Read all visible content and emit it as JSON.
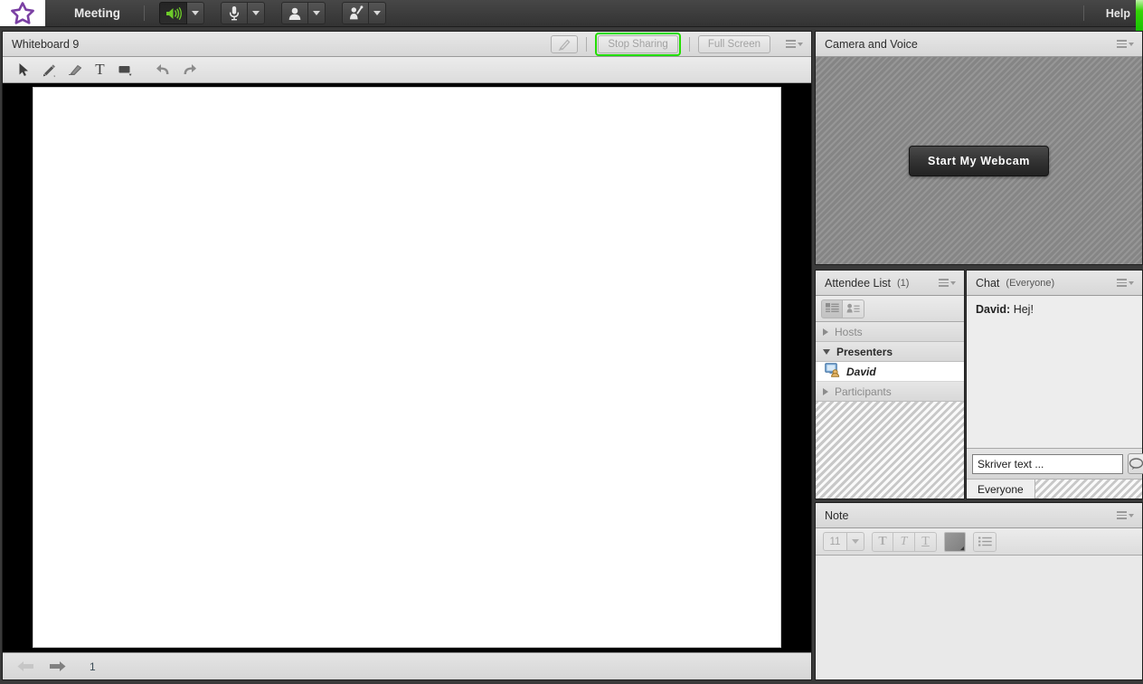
{
  "appbar": {
    "logo_icon": "star-logo-icon",
    "menu_label": "Meeting",
    "help_label": "Help",
    "controls": [
      {
        "name": "speaker-button",
        "icon": "speaker-icon",
        "state": "active",
        "accent": "#6ecc2a"
      },
      {
        "name": "microphone-button",
        "icon": "microphone-icon",
        "state": "normal"
      },
      {
        "name": "webcam-button",
        "icon": "person-icon",
        "state": "normal"
      },
      {
        "name": "raise-hand-button",
        "icon": "raise-hand-icon",
        "state": "normal"
      }
    ],
    "green_edge_color": "#22dd00"
  },
  "whiteboard": {
    "title": "Whiteboard 9",
    "header_buttons": {
      "draw_toggle_label": "",
      "stop_sharing_label": "Stop Sharing",
      "full_screen_label": "Full Screen",
      "focus_outline_color": "#22dd00"
    },
    "tools": [
      {
        "name": "pointer-tool",
        "icon": "pointer-icon"
      },
      {
        "name": "pencil-tool",
        "icon": "pencil-icon"
      },
      {
        "name": "eraser-tool",
        "icon": "eraser-icon"
      },
      {
        "name": "text-tool",
        "icon": "text-icon",
        "glyph": "T"
      },
      {
        "name": "shape-tool",
        "icon": "rectangle-icon"
      },
      {
        "name": "undo-tool",
        "icon": "undo-arrow-icon"
      },
      {
        "name": "redo-tool",
        "icon": "redo-arrow-icon"
      }
    ],
    "footer": {
      "prev_icon": "arrow-left-icon",
      "next_icon": "arrow-right-icon",
      "page_number": "1"
    }
  },
  "camera_pod": {
    "title": "Camera and Voice",
    "start_webcam_label": "Start My Webcam"
  },
  "attendee_pod": {
    "title": "Attendee List",
    "count": "(1)",
    "view_toggles": [
      {
        "name": "list-view-toggle",
        "icon": "list-view-icon",
        "selected": true
      },
      {
        "name": "card-view-toggle",
        "icon": "card-view-icon",
        "selected": false
      }
    ],
    "groups": [
      {
        "label": "Hosts",
        "expanded": false,
        "members": []
      },
      {
        "label": "Presenters",
        "expanded": true,
        "members": [
          {
            "name": "David",
            "icon": "presenter-screen-icon"
          }
        ]
      },
      {
        "label": "Participants",
        "expanded": false,
        "members": []
      }
    ]
  },
  "chat_pod": {
    "title": "Chat",
    "scope": "(Everyone)",
    "messages": [
      {
        "sender": "David:",
        "text": "Hej!"
      }
    ],
    "input_value": "Skriver text ...",
    "input_placeholder": "Skriver text ...",
    "send_icon": "speech-bubble-icon",
    "tabs": [
      {
        "label": "Everyone",
        "active": true
      }
    ]
  },
  "note_pod": {
    "title": "Note",
    "font_size": "11",
    "toolbar": [
      {
        "name": "bold-button",
        "glyph": "T"
      },
      {
        "name": "italic-button",
        "glyph": "T"
      },
      {
        "name": "underline-button",
        "glyph": "T"
      },
      {
        "name": "font-color-button",
        "glyph": ""
      },
      {
        "name": "bullet-list-button",
        "glyph": ""
      }
    ],
    "body_text": ""
  }
}
